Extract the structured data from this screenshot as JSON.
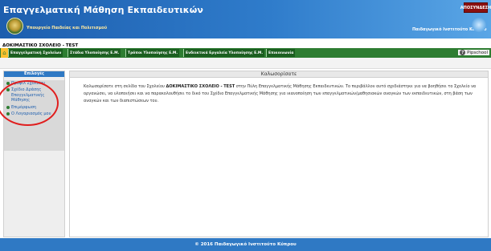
{
  "header": {
    "site_title": "Επαγγελματική Μάθηση Εκπαιδευτικών",
    "ministry": "Υπουργείο Παιδείας και Πολιτισμού",
    "logout_label": "ΑΠΟΣΥΝΔΕΣΗ",
    "institute": "Παιδαγωγικό Ινστιτούτο Κύπρου"
  },
  "school_name": "ΔΟΚΙΜΑΣΤΙΚΟ ΣΧΟΛΕΙΟ - TEST",
  "nav": {
    "home_icon": "home-icon",
    "tabs": [
      {
        "label": "Επαγγελματική Σχολείων"
      },
      {
        "label": "Στάδια Υλοποίησης Ε.Μ."
      },
      {
        "label": "Τρόποι Υλοποίησης Ε.Μ."
      },
      {
        "label": "Ενδεικτικά Εργαλεία Υλοποίησης Ε.Μ."
      },
      {
        "label": "Επικοινωνία"
      }
    ],
    "help_label": "Pipschool"
  },
  "sidebar": {
    "title": "Επιλογές",
    "items": [
      {
        "label": "Προφίλ Σχολείου"
      },
      {
        "label": "Σχέδιο Δράσης Επαγγελματικής Μάθησης"
      },
      {
        "label": "Επιμόρφωση"
      },
      {
        "label": "Ο Λογαριασμός μου"
      }
    ]
  },
  "main": {
    "title": "Καλωσορίσατε",
    "welcome_prefix": "Καλωσορίσατε στη σελίδα του Σχολείου ",
    "welcome_school": "ΔΟΚΙΜΑΣΤΙΚΟ ΣΧΟΛΕΙΟ - TEST",
    "welcome_suffix": " στην Πύλη Επαγγελματικής Μάθησης Εκπαιδευτικών. Το περιβάλλον αυτό σχεδιάστηκε για να βοηθήσει το Σχολείο να οργανώσει, να υλοποιήσει και να παρακολουθήσει το δικό του Σχέδιο Επαγγελματικής Μάθησης για ικανοποίηση των επαγγελματικών/μαθησιακών αναγκών των εκπαιδευτικών, στη βάση των αναγκών και των διαπιστώσεων του."
  },
  "footer": {
    "text": "© 2016 Παιδαγωγικό Ινστιτούτο Κύπρου"
  },
  "colors": {
    "header_blue": "#1d5eae",
    "nav_green": "#2e7d32",
    "annotation_red": "#e01e1e",
    "logout_red": "#8a1010"
  }
}
